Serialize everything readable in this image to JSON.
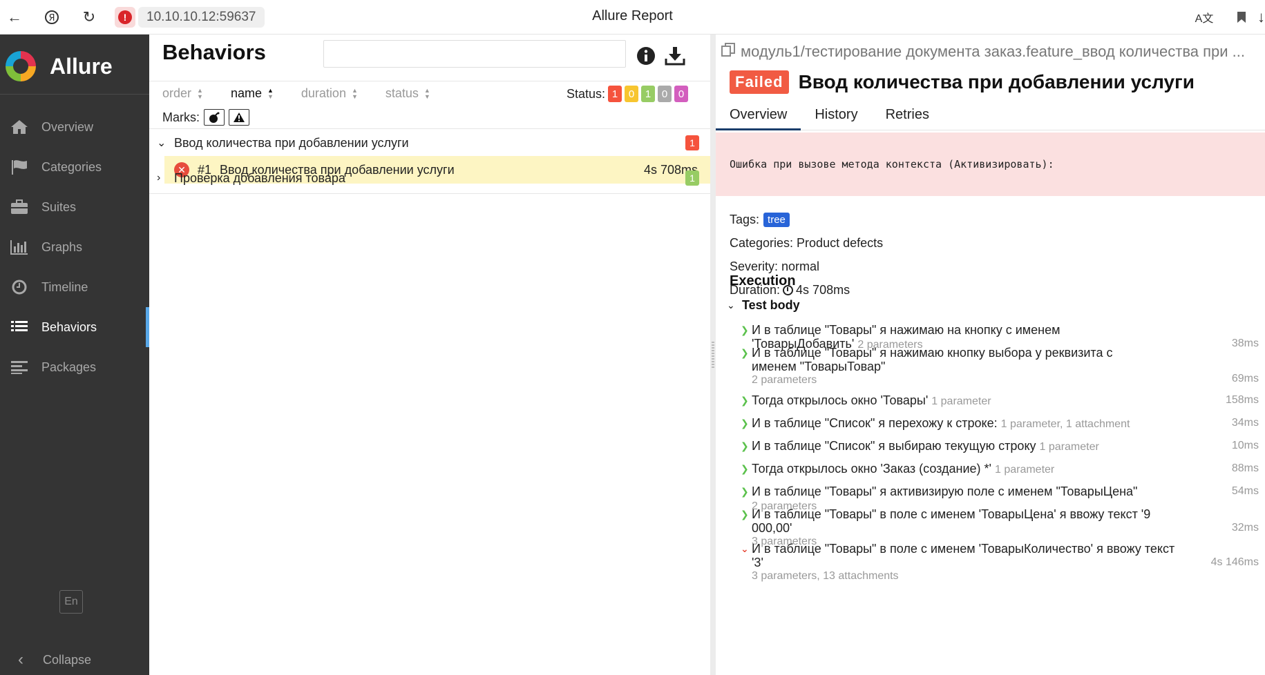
{
  "browser": {
    "url": "10.10.10.12:59637",
    "title": "Allure Report"
  },
  "sidebar": {
    "logo": "Allure",
    "items": [
      {
        "label": "Overview",
        "icon": "home-icon"
      },
      {
        "label": "Categories",
        "icon": "flag-icon"
      },
      {
        "label": "Suites",
        "icon": "briefcase-icon"
      },
      {
        "label": "Graphs",
        "icon": "bar-chart-icon"
      },
      {
        "label": "Timeline",
        "icon": "clock-icon"
      },
      {
        "label": "Behaviors",
        "icon": "list-icon",
        "active": true
      },
      {
        "label": "Packages",
        "icon": "align-left-icon"
      }
    ],
    "language": "En",
    "collapse": "Collapse"
  },
  "behaviors": {
    "title": "Behaviors",
    "search_value": "",
    "sort": {
      "order": "order",
      "name": "name",
      "duration": "duration",
      "status": "status"
    },
    "status_label": "Status:",
    "status_counts": [
      {
        "value": "1",
        "color": "#f5533d"
      },
      {
        "value": "0",
        "color": "#f7c52f"
      },
      {
        "value": "1",
        "color": "#97cc64"
      },
      {
        "value": "0",
        "color": "#aaaaaa"
      },
      {
        "value": "0",
        "color": "#d35ebe"
      }
    ],
    "marks_label": "Marks:",
    "groups": [
      {
        "name": "Ввод количества при добавлении услуги",
        "count": "1",
        "color": "#f5533d"
      },
      {
        "name": "Проверка добавления товара",
        "count": "1",
        "color": "#97cc64"
      }
    ],
    "selected_row": {
      "number": "#1",
      "name": "Ввод количества при добавлении услуги",
      "duration": "4s 708ms"
    }
  },
  "detail": {
    "breadcrumb": "модуль1/тестирование документа заказ.feature_ввод количества при ...",
    "status": "Failed",
    "title": "Ввод количества при добавлении услуги",
    "tabs": [
      "Overview",
      "History",
      "Retries"
    ],
    "error": "Ошибка при вызове метода контекста (Активизировать):",
    "tags_label": "Tags:",
    "tag": "tree",
    "categories": "Categories: Product defects",
    "severity": "Severity: normal",
    "duration_label": "Duration:",
    "duration": "4s 708ms",
    "execution": "Execution",
    "test_body": "Test body",
    "steps": [
      {
        "text": "И в таблице \"Товары\" я нажимаю на кнопку с именем 'ТоварыДобавить'",
        "meta": "2 parameters",
        "sub": "",
        "time": "38ms"
      },
      {
        "text": "И в таблице \"Товары\" я нажимаю кнопку выбора у реквизита с именем \"ТоварыТовар\"",
        "meta": "",
        "sub": "2 parameters",
        "time": "69ms"
      },
      {
        "text": "Тогда открылось окно 'Товары'",
        "meta": "1 parameter",
        "sub": "",
        "time": "158ms"
      },
      {
        "text": "И в таблице \"Список\" я перехожу к строке:",
        "meta": "1 parameter, 1 attachment",
        "sub": "",
        "time": "34ms"
      },
      {
        "text": "И в таблице \"Список\" я выбираю текущую строку",
        "meta": "1 parameter",
        "sub": "",
        "time": "10ms"
      },
      {
        "text": "Тогда открылось окно 'Заказ (создание) *'",
        "meta": "1 parameter",
        "sub": "",
        "time": "88ms"
      },
      {
        "text": "И в таблице \"Товары\" я активизирую поле с именем \"ТоварыЦена\"",
        "meta": "2 parameters",
        "sub": "",
        "time": "54ms"
      },
      {
        "text": "И в таблице \"Товары\" в поле с именем 'ТоварыЦена' я ввожу текст '9 000,00'",
        "meta": "",
        "sub": "3 parameters",
        "time": "32ms"
      },
      {
        "text": "И в таблице \"Товары\" в поле с именем 'ТоварыКоличество' я ввожу текст '3'",
        "meta": "",
        "sub": "3 parameters, 13 attachments",
        "time": "4s 146ms",
        "failed": true
      }
    ]
  }
}
